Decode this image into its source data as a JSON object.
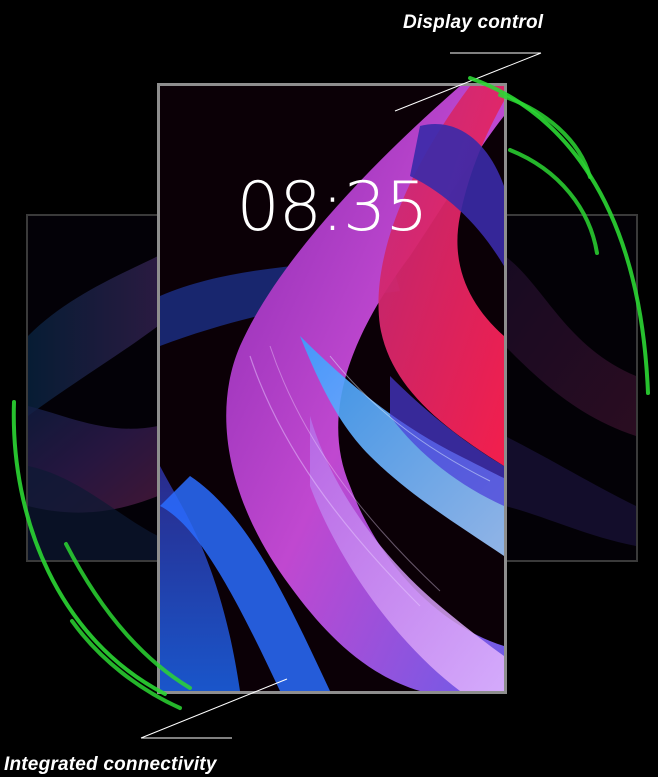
{
  "callouts": {
    "display_control": "Display control",
    "integrated_connectivity": "Integrated connectivity"
  },
  "display": {
    "clock_time": "08:35"
  },
  "colors": {
    "background": "#000000",
    "accent_green": "#2bd633",
    "bezel": "#8e8e8e",
    "wallpaper_magenta": "#c03cc8",
    "wallpaper_blue": "#2f7cff",
    "wallpaper_red": "#e0205a"
  }
}
